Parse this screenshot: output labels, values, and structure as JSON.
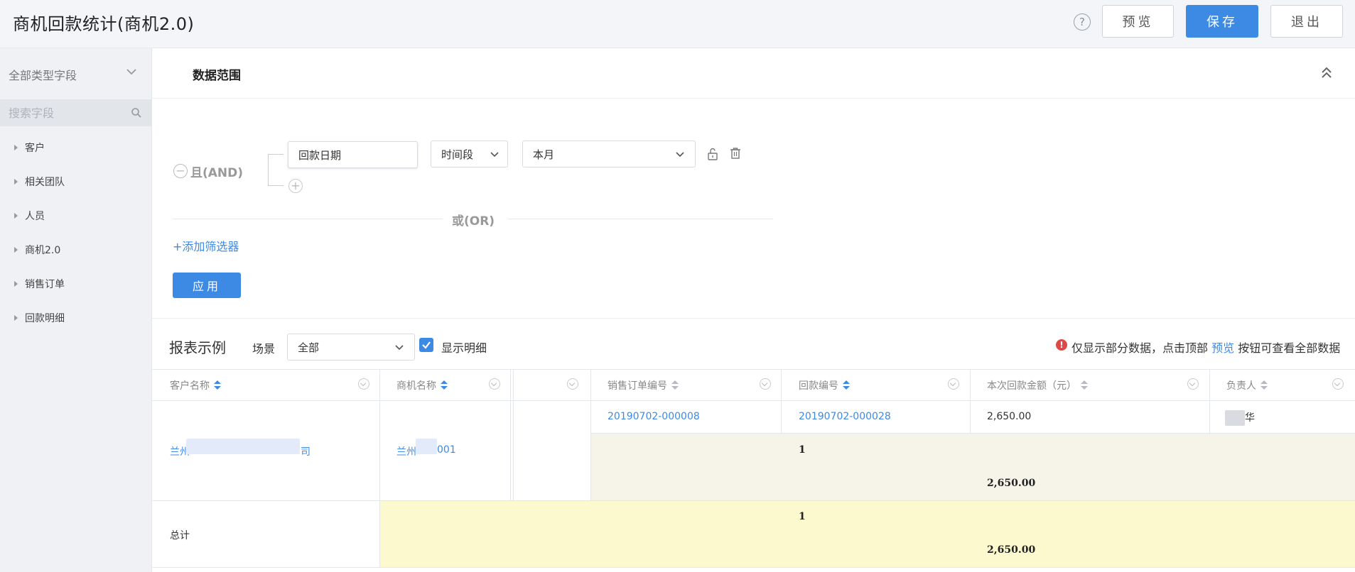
{
  "header": {
    "title": "商机回款统计(商机2.0)",
    "buttons": {
      "preview": "预览",
      "save": "保存",
      "exit": "退出"
    }
  },
  "sidebar": {
    "field_type": "全部类型字段",
    "search_placeholder": "搜索字段",
    "items": [
      {
        "label": "客户"
      },
      {
        "label": "相关团队"
      },
      {
        "label": "人员"
      },
      {
        "label": "商机2.0"
      },
      {
        "label": "销售订单"
      },
      {
        "label": "回款明细"
      }
    ]
  },
  "filter": {
    "section_title": "数据范围",
    "and_label": "且(AND)",
    "or_label": "或(OR)",
    "condition": {
      "field": "回款日期",
      "operator": "时间段",
      "value": "本月"
    },
    "add_filter": "+添加筛选器",
    "apply": "应用"
  },
  "report": {
    "title": "报表示例",
    "scene_label": "场景",
    "scene_value": "全部",
    "show_detail_label": "显示明细",
    "show_detail_checked": true,
    "notice_prefix": "仅显示部分数据，点击顶部",
    "notice_link": "预览",
    "notice_suffix": "按钮可查看全部数据"
  },
  "table": {
    "columns": [
      "客户名称",
      "商机名称",
      "",
      "销售订单编号",
      "回款编号",
      "本次回款金额（元）",
      "负责人"
    ],
    "row": {
      "customer": "兰州",
      "customer_tail": "司",
      "opportunity": "兰州",
      "opportunity_tail": "001",
      "order_no": "20190702-000008",
      "payment_no": "20190702-000028",
      "amount": "2,650.00",
      "owner_tail": "华"
    },
    "subtotal": {
      "count": "1",
      "amount": "2,650.00"
    },
    "total": {
      "label": "总计",
      "count": "1",
      "amount": "2,650.00"
    }
  },
  "colors": {
    "primary": "#3d8ae5",
    "subtotal_bg": "#f6f4e8",
    "total_bg": "#fdf9cf"
  }
}
